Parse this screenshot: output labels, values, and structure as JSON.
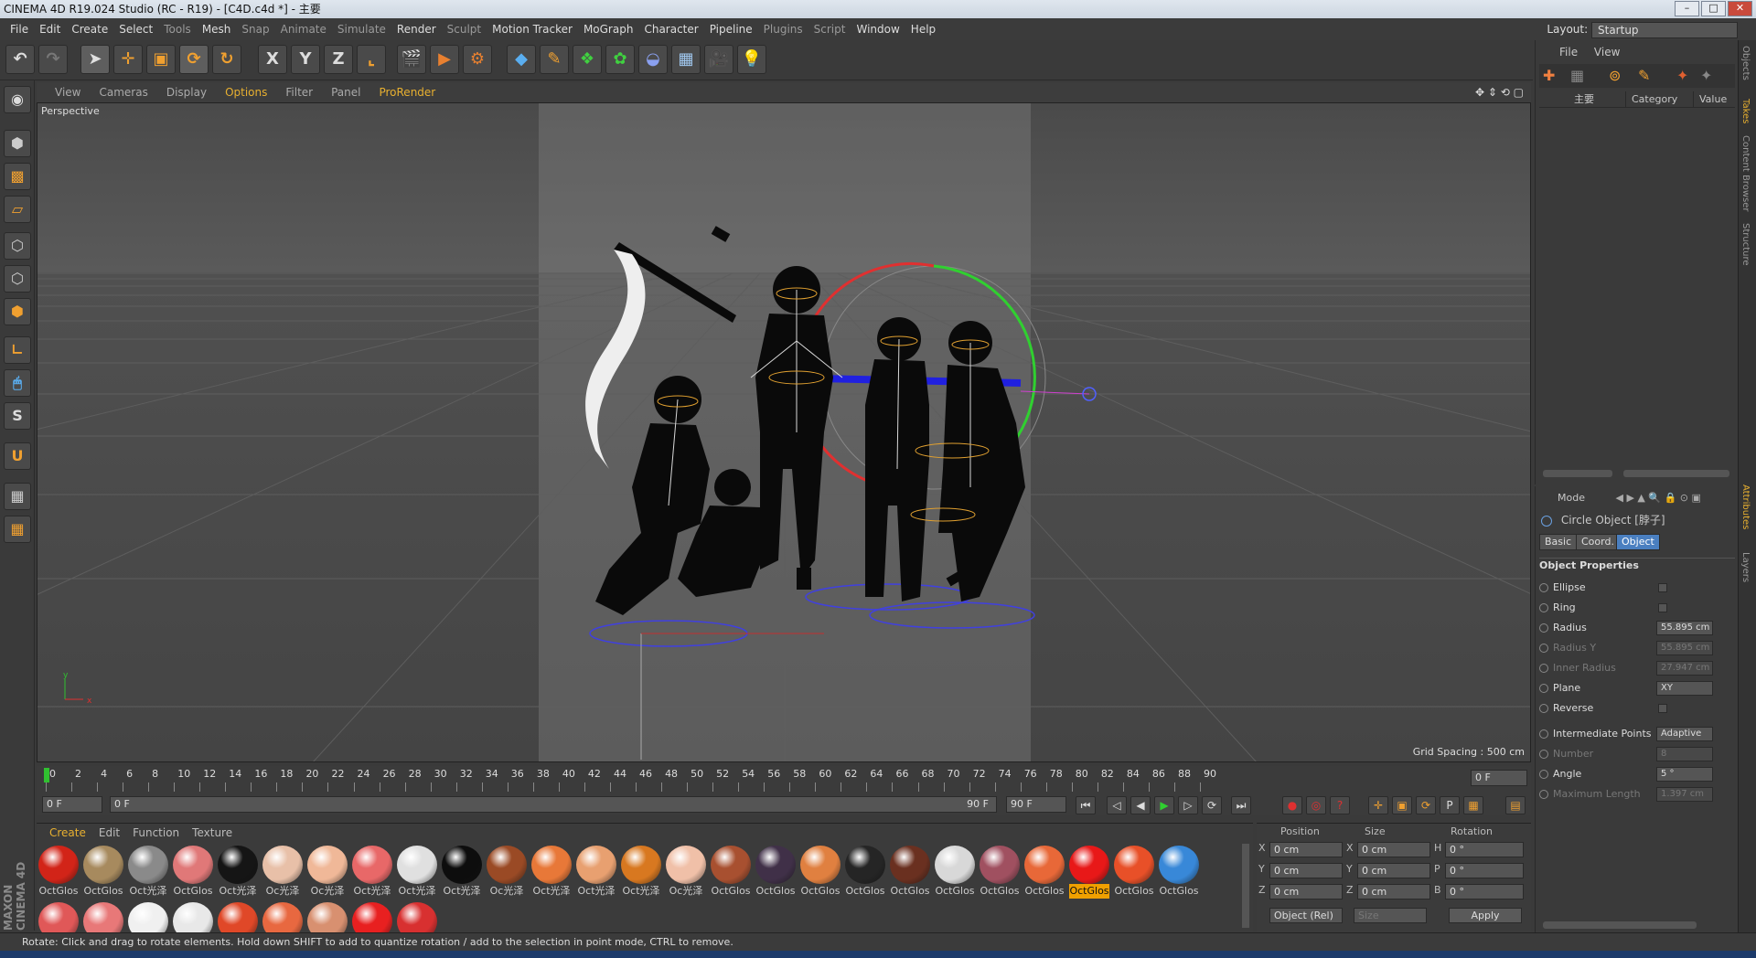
{
  "window": {
    "title": "CINEMA 4D R19.024 Studio (RC - R19) - [C4D.c4d *] - 主要"
  },
  "menu": [
    "File",
    "Edit",
    "Create",
    "Select",
    "Tools",
    "Mesh",
    "Snap",
    "Animate",
    "Simulate",
    "Render",
    "Sculpt",
    "Motion Tracker",
    "MoGraph",
    "Character",
    "Pipeline",
    "Plugins",
    "Script",
    "Window",
    "Help"
  ],
  "layout": {
    "label": "Layout:",
    "value": "Startup"
  },
  "viewport": {
    "menu": [
      "View",
      "Cameras",
      "Display",
      "Options",
      "Filter",
      "Panel",
      "ProRender"
    ],
    "name": "Perspective",
    "grid_spacing": "Grid Spacing : 500 cm"
  },
  "timeline": {
    "ticks": [
      "0",
      "2",
      "4",
      "6",
      "8",
      "10",
      "12",
      "14",
      "16",
      "18",
      "20",
      "22",
      "24",
      "26",
      "28",
      "30",
      "32",
      "34",
      "36",
      "38",
      "40",
      "42",
      "44",
      "46",
      "48",
      "50",
      "52",
      "54",
      "56",
      "58",
      "60",
      "62",
      "64",
      "66",
      "68",
      "70",
      "72",
      "74",
      "76",
      "78",
      "80",
      "82",
      "84",
      "86",
      "88",
      "90"
    ],
    "current_frame": "0 F",
    "start": "0 F",
    "range_start": "0 F",
    "range_end": "90 F",
    "end": "90 F"
  },
  "materials": {
    "menu": [
      "Create",
      "Edit",
      "Function",
      "Texture"
    ],
    "row1": [
      {
        "name": "OctGlos",
        "color": "#d22418"
      },
      {
        "name": "OctGlos",
        "color": "#a78a5e"
      },
      {
        "name": "Oct光泽",
        "color": "#8a8a8a"
      },
      {
        "name": "OctGlos",
        "color": "#e07878"
      },
      {
        "name": "Oct光泽",
        "color": "#151515"
      },
      {
        "name": "Oc光泽",
        "color": "#e8c0a8"
      },
      {
        "name": "Oc光泽",
        "color": "#f0b898"
      },
      {
        "name": "Oct光泽",
        "color": "#e86868"
      },
      {
        "name": "Oct光泽",
        "color": "#e0e0e0"
      },
      {
        "name": "Oct光泽",
        "color": "#0d0d0d"
      },
      {
        "name": "Oc光泽",
        "color": "#9a4a25"
      },
      {
        "name": "Oct光泽",
        "color": "#e87838"
      },
      {
        "name": "Oct光泽",
        "color": "#e8a070"
      },
      {
        "name": "Oct光泽",
        "color": "#d87820"
      },
      {
        "name": "Oc光泽",
        "color": "#f0c0a8"
      },
      {
        "name": "OctGlos",
        "color": "#a85030"
      },
      {
        "name": "OctGlos",
        "color": "#403048"
      },
      {
        "name": "OctGlos",
        "color": "#e08040"
      },
      {
        "name": "OctGlos",
        "color": "#252525"
      },
      {
        "name": "OctGlos",
        "color": "#6a3020"
      },
      {
        "name": "OctGlos",
        "color": "#d8d8d8"
      },
      {
        "name": "OctGlos",
        "color": "#a05060"
      },
      {
        "name": "OctGlos",
        "color": "#e86838"
      },
      {
        "name": "OctGlos",
        "color": "#e81818",
        "selected": true
      },
      {
        "name": "OctGlos",
        "color": "#e85028"
      },
      {
        "name": "OctGlos",
        "color": "#3888d8"
      }
    ],
    "row2": [
      "#e05858",
      "#e87878",
      "#f0f0f0",
      "#e8e8e8",
      "#e04828",
      "#e86840",
      "#d89070",
      "#e82020",
      "#d83030"
    ]
  },
  "coords": {
    "headers": [
      "Position",
      "Size",
      "Rotation"
    ],
    "rows": [
      {
        "axis": "X",
        "pos": "0 cm",
        "saxis": "X",
        "size": "0 cm",
        "raxis": "H",
        "rot": "0 °"
      },
      {
        "axis": "Y",
        "pos": "0 cm",
        "saxis": "Y",
        "size": "0 cm",
        "raxis": "P",
        "rot": "0 °"
      },
      {
        "axis": "Z",
        "pos": "0 cm",
        "saxis": "Z",
        "size": "0 cm",
        "raxis": "B",
        "rot": "0 °"
      }
    ],
    "mode": "Object (Rel)",
    "size_mode": "Size",
    "apply": "Apply"
  },
  "objects": {
    "menu": [
      "File",
      "View"
    ],
    "tree_item": "主要",
    "columns": [
      "Category",
      "Value"
    ]
  },
  "attributes": {
    "mode": "Mode",
    "object_title": "Circle Object [脖子]",
    "tabs": [
      "Basic",
      "Coord.",
      "Object"
    ],
    "section": "Object Properties",
    "props": [
      {
        "label": "Ellipse",
        "type": "check"
      },
      {
        "label": "Ring",
        "type": "check"
      },
      {
        "label": "Radius",
        "value": "55.895 cm"
      },
      {
        "label": "Radius Y",
        "value": "55.895 cm",
        "dim": true
      },
      {
        "label": "Inner Radius",
        "value": "27.947 cm",
        "dim": true
      },
      {
        "label": "Plane",
        "value": "XY"
      },
      {
        "label": "Reverse",
        "type": "check"
      },
      {
        "label": "Intermediate Points",
        "value": "Adaptive"
      },
      {
        "label": "Number",
        "value": "8",
        "dim": true
      },
      {
        "label": "Angle",
        "value": "5 °"
      },
      {
        "label": "Maximum Length",
        "value": "1.397 cm",
        "dim": true
      }
    ]
  },
  "side_tabs": [
    "Objects",
    "Takes",
    "Content Browser",
    "Structure",
    "Attributes",
    "Layers"
  ],
  "status": "Rotate: Click and drag to rotate elements. Hold down SHIFT to add to quantize rotation / add to the selection in point mode, CTRL to remove.",
  "brand": "MAXON CINEMA 4D"
}
